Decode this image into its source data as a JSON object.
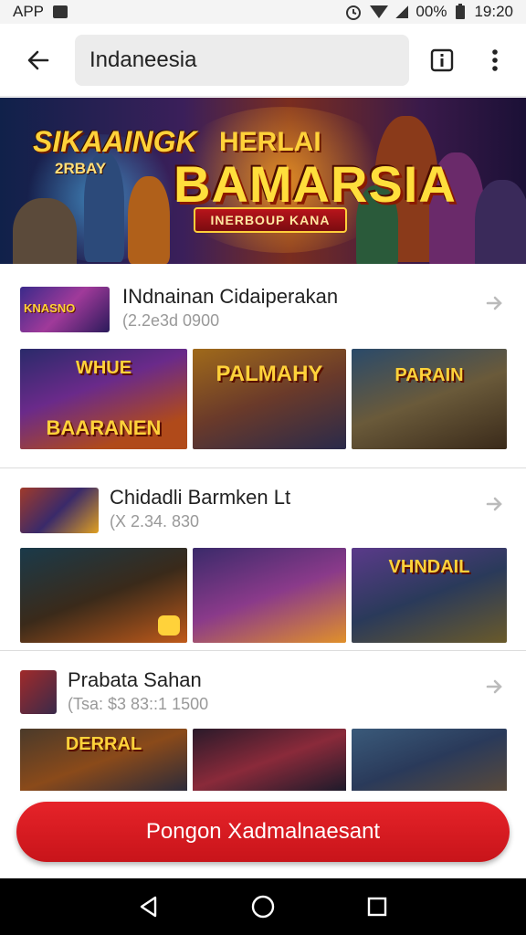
{
  "status_bar": {
    "left_text": "APP",
    "battery_text": "00%",
    "time": "19:20"
  },
  "app_bar": {
    "search_value": "Indaneesia",
    "icons": [
      "back-arrow-icon",
      "info-icon",
      "more-vert-icon"
    ]
  },
  "hero": {
    "left_title": "SIKAAINGK",
    "left_sub": "2RBAY",
    "top_text": "HERLAI",
    "main_title": "BAMARSIA",
    "banner_text": "INERBOUP KANA"
  },
  "sections": [
    {
      "title": "INdnainan Cidaiperakan",
      "meta": "(2.2e3d 0900",
      "icon_text": "KNASNO",
      "thumbs": [
        "BAARANEN",
        "PALMAHY",
        "PARAIN"
      ]
    },
    {
      "title": "Chidadli Barmken Lt",
      "meta": "(X 2.34. 830",
      "icon_text": "",
      "thumbs": [
        "",
        "",
        "VHNDAIL"
      ]
    },
    {
      "title": "Prabata Sahan",
      "meta": "(Tsa: $3 83::1 1500",
      "icon_text": "",
      "thumbs": [
        "DERRAL",
        "",
        ""
      ]
    }
  ],
  "cta": {
    "label": "Pongon Xadmalnaesant"
  },
  "nav": [
    "back-triangle-icon",
    "home-circle-icon",
    "recents-square-icon"
  ],
  "colors": {
    "accent": "#d81a20",
    "title_gold": "#ffd23a"
  }
}
